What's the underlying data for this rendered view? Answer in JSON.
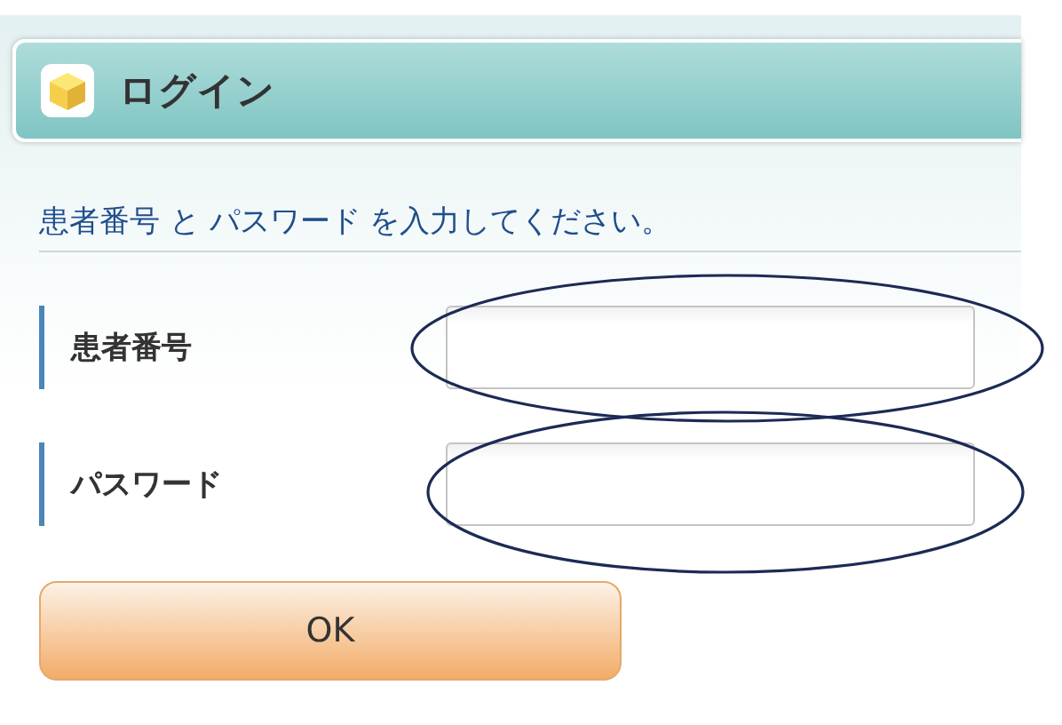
{
  "header": {
    "title": "ログイン"
  },
  "instruction": "患者番号 と パスワード を入力してください。",
  "fields": [
    {
      "label": "患者番号",
      "circled": true
    },
    {
      "label": "パスワード",
      "circled": true
    }
  ],
  "buttons": [
    "OK"
  ]
}
